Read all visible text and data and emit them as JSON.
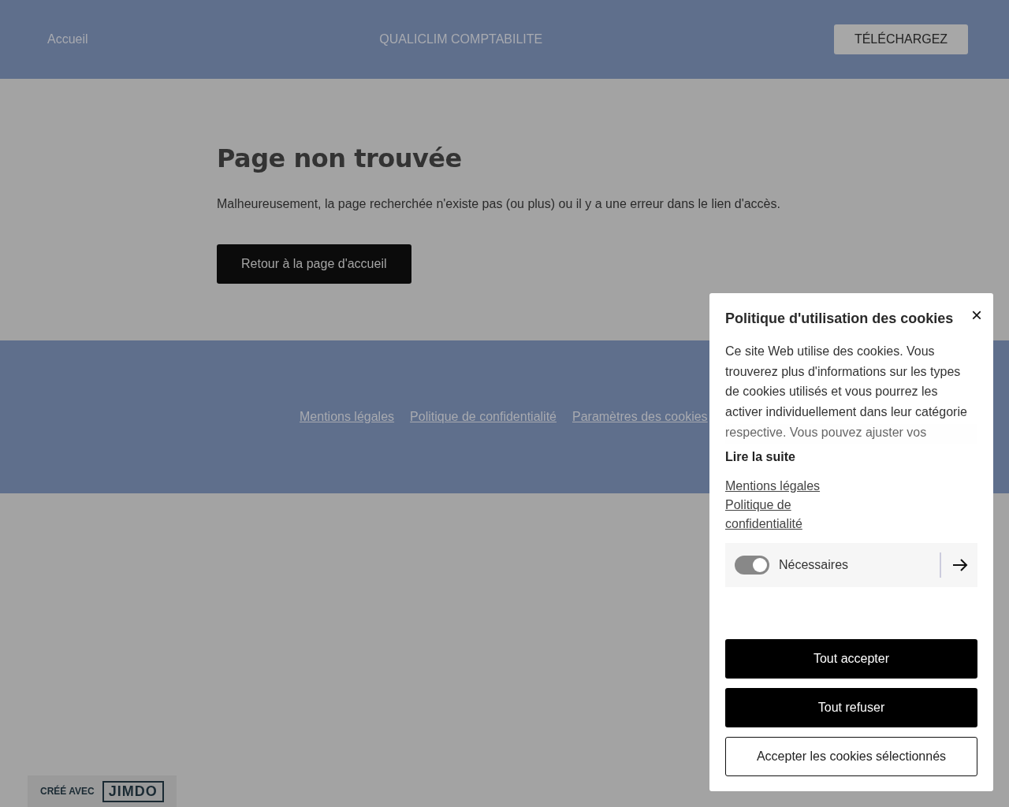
{
  "header": {
    "nav_link": "Accueil",
    "site_title": "QUALICLIM COMPTABILITE",
    "download_button": "TÉLÉCHARGEZ"
  },
  "main": {
    "heading": "Page non trouvée",
    "message": "Malheureusement, la page recherchée n'existe pas (ou plus) ou il y a une erreur dans le lien d'accès.",
    "home_button": "Retour à la page d'accueil"
  },
  "footer": {
    "links": [
      "Mentions légales",
      "Politique de confidentialité",
      "Paramètres des cookies"
    ]
  },
  "badge": {
    "prefix": "CRÉÉ AVEC",
    "brand": "JIMDO"
  },
  "cookie_dialog": {
    "title": "Politique d'utilisation des cookies",
    "close": "×",
    "body": "Ce site Web utilise des cookies. Vous trouverez plus d'informations sur les types de cookies utilisés et vous pourrez les activer individuellement dans leur catégorie respective. Vous pouvez ajuster vos",
    "read_more": "Lire la suite",
    "links": [
      "Mentions légales",
      "Politique de confidentialité"
    ],
    "categories": [
      {
        "label": "Nécessaires",
        "on": true,
        "disabled": true
      }
    ],
    "buttons": [
      {
        "label": "Tout accepter",
        "kind": "primary"
      },
      {
        "label": "Tout refuser",
        "kind": "primary"
      },
      {
        "label": "Accepter les cookies sélectionnés",
        "kind": "outline"
      }
    ]
  }
}
